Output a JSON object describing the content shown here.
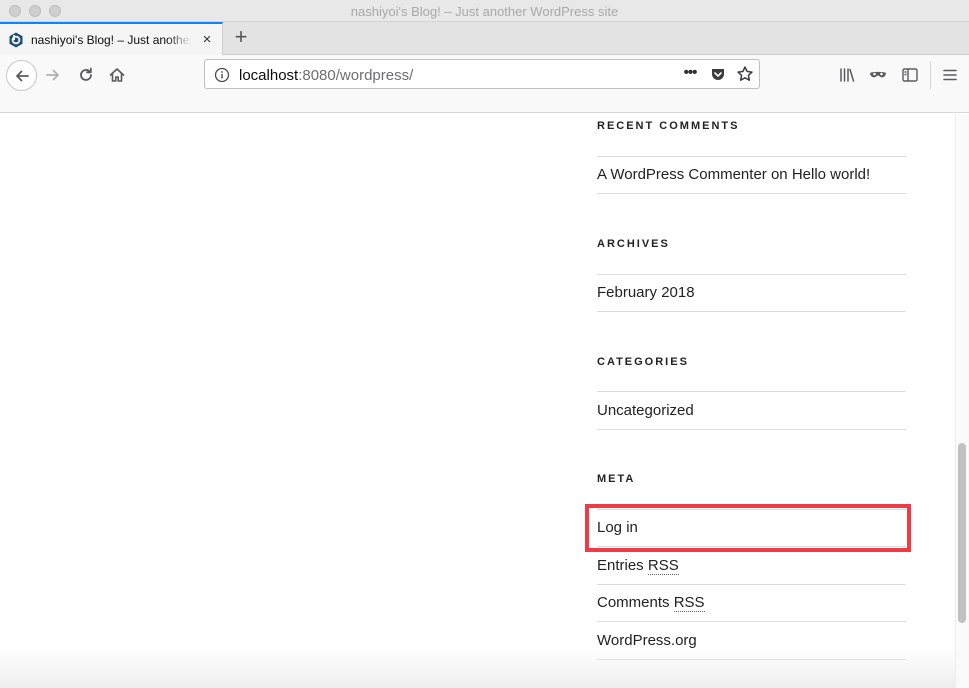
{
  "window": {
    "title": "nashiyoi's Blog! – Just another WordPress site"
  },
  "tab": {
    "label": "nashiyoi's Blog! – Just another WordPress site",
    "close": "×",
    "new_tab": "+"
  },
  "url": {
    "host": "localhost",
    "rest": ":8080/wordpress/",
    "more": "•••"
  },
  "colors": {
    "accent": "#0a84ff",
    "highlight": "#ef3b45"
  },
  "sidebar": {
    "recent_comments": {
      "title": "RECENT COMMENTS",
      "comment": {
        "author": "A WordPress Commenter",
        "on": " on ",
        "post": "Hello world!"
      }
    },
    "archives": {
      "title": "ARCHIVES",
      "items": [
        "February 2018"
      ]
    },
    "categories": {
      "title": "CATEGORIES",
      "items": [
        "Uncategorized"
      ]
    },
    "meta": {
      "title": "META",
      "login": "Log in",
      "entries_prefix": "Entries ",
      "comments_prefix": "Comments ",
      "rss": "RSS",
      "wordpress_org": "WordPress.org"
    }
  },
  "icons": [
    "back-arrow-icon",
    "forward-arrow-icon",
    "reload-icon",
    "home-icon",
    "info-icon",
    "pocket-icon",
    "star-icon",
    "library-icon",
    "private-mask-icon",
    "sidebar-icon",
    "hamburger-menu-icon",
    "site-favicon-icon",
    "close-icon"
  ]
}
